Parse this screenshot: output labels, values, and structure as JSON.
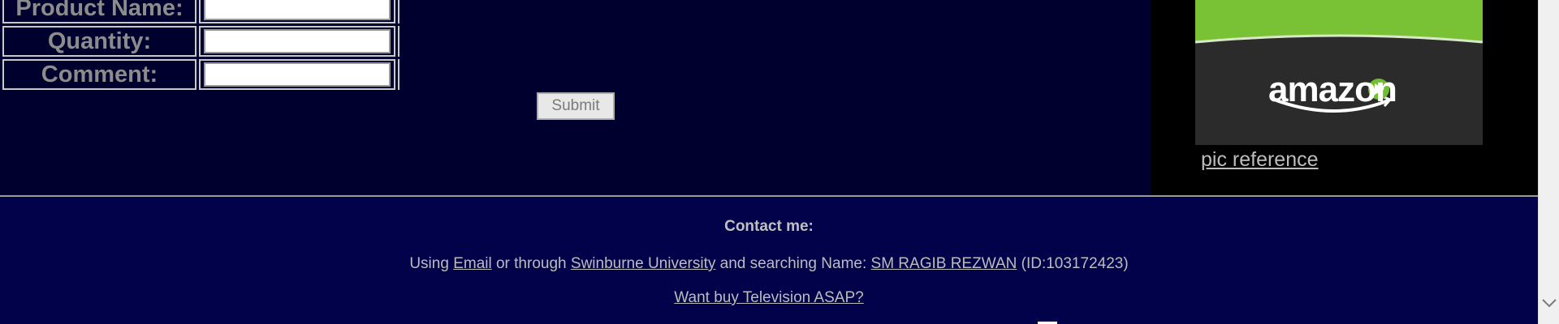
{
  "form": {
    "rows": [
      {
        "label": "Product Name:"
      },
      {
        "label": "Quantity:"
      },
      {
        "label": "Comment:"
      }
    ],
    "submit_label": "Submit"
  },
  "aside": {
    "logo_text": "amazon",
    "pic_reference": "pic reference"
  },
  "footer": {
    "contact_title": "Contact me:",
    "using": "Using",
    "email_link": "Email",
    "or_through": "or through",
    "university_link": "Swinburne University",
    "and_searching": "and searching Name:",
    "name_link": "SM RAGIB REZWAN",
    "id_text": "(ID:103172423)",
    "want_link": "Want buy Television ASAP?"
  },
  "icons": {
    "scroll_down": "chevron-down-icon"
  }
}
